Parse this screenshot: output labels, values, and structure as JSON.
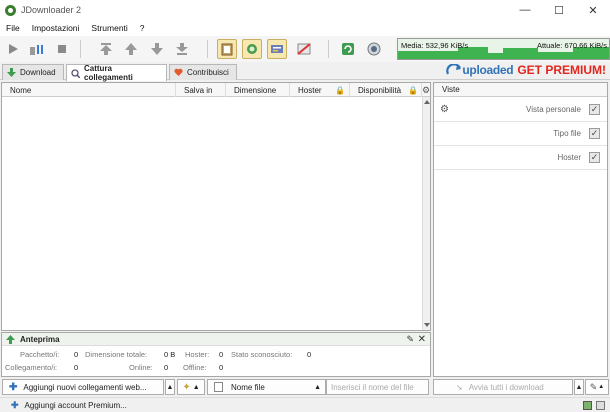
{
  "window": {
    "title": "JDownloader 2",
    "minimize_glyph": "—",
    "maximize_glyph": "☐",
    "close_glyph": "✕"
  },
  "menu": [
    "File",
    "Impostazioni",
    "Strumenti",
    "?"
  ],
  "toolbar": {
    "icons": [
      "play-icon",
      "pause-icon",
      "stop-icon",
      "move-to-top-icon",
      "move-up-icon",
      "move-down-icon",
      "move-to-bottom-icon",
      "clipboard-monitor-icon",
      "auto-reconnect-icon",
      "premium-icon",
      "silent-mode-icon",
      "reconnect-icon",
      "update-icon"
    ]
  },
  "speed": {
    "average": "Media: 532,96 KiB/s",
    "current": "Attuale: 670,66 KiB/s"
  },
  "tabs": [
    {
      "label": "Download",
      "icon": "download-arrow-icon",
      "active": false
    },
    {
      "label": "Cattura collegamenti",
      "icon": "linkgrabber-icon",
      "active": true
    },
    {
      "label": "Contribuisci",
      "icon": "heart-icon",
      "active": false
    }
  ],
  "banner": {
    "brand": "uploaded",
    "cta": "GET PREMIUM!"
  },
  "columns": [
    "Nome",
    "Salva in",
    "Dimensione",
    "Hoster",
    "Disponibilità"
  ],
  "side_panel": {
    "header": "Viste",
    "options": [
      {
        "label": "Vista personale",
        "checked": true
      },
      {
        "label": "Tipo file",
        "checked": true
      },
      {
        "label": "Hoster",
        "checked": true
      }
    ]
  },
  "preview": {
    "title": "Anteprima",
    "row1": [
      {
        "k": "Pacchetto/i:",
        "v": "0"
      },
      {
        "k": "Dimensione totale:",
        "v": "0 B"
      },
      {
        "k": "Hoster:",
        "v": "0"
      },
      {
        "k": "Stato sconosciuto:",
        "v": "0"
      }
    ],
    "row2": [
      {
        "k": "Collegamento/i:",
        "v": "0"
      },
      {
        "k": "Online:",
        "v": "0"
      },
      {
        "k": "Offline:",
        "v": "0"
      }
    ]
  },
  "bottom": {
    "add_links": "Aggiungi nuovi collegamenti web...",
    "filter_label": "Nome file",
    "filter_placeholder": "Inserisci il nome del file",
    "start_all": "Avvia tutti i download"
  },
  "status": {
    "add_account": "Aggiungi account Premium..."
  },
  "colors": {
    "speed_fill": "#3fb34f",
    "brand_blue": "#3273b8",
    "brand_red": "#e2261c"
  }
}
